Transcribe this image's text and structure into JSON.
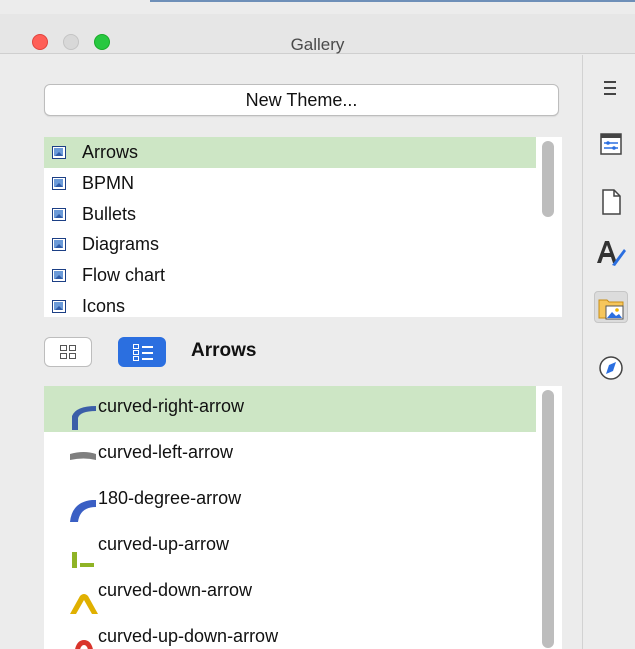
{
  "window": {
    "title": "Gallery"
  },
  "gallery": {
    "new_theme_label": "New Theme...",
    "themes": [
      {
        "label": "Arrows",
        "selected": true
      },
      {
        "label": "BPMN",
        "selected": false
      },
      {
        "label": "Bullets",
        "selected": false
      },
      {
        "label": "Diagrams",
        "selected": false
      },
      {
        "label": "Flow chart",
        "selected": false
      },
      {
        "label": "Icons",
        "selected": false
      }
    ],
    "view_mode": "list",
    "current_theme": "Arrows",
    "items": [
      {
        "label": "curved-right-arrow",
        "selected": true,
        "thumb_color": "#3b5ea8",
        "thumb_icon": "curved-right-arrow-icon"
      },
      {
        "label": "curved-left-arrow",
        "selected": false,
        "thumb_color": "#7f7f7f",
        "thumb_icon": "curved-left-arrow-icon"
      },
      {
        "label": "180-degree-arrow",
        "selected": false,
        "thumb_color": "#3a5fc4",
        "thumb_icon": "180-degree-arrow-icon"
      },
      {
        "label": "curved-up-arrow",
        "selected": false,
        "thumb_color": "#8fb325",
        "thumb_icon": "curved-up-arrow-icon"
      },
      {
        "label": "curved-down-arrow",
        "selected": false,
        "thumb_color": "#e0b000",
        "thumb_icon": "curved-down-arrow-icon"
      },
      {
        "label": "curved-up-down-arrow",
        "selected": false,
        "thumb_color": "#d9342b",
        "thumb_icon": "curved-up-down-arrow-icon"
      }
    ]
  },
  "sidebar_tabs": [
    {
      "icon": "menu-icon",
      "active": false
    },
    {
      "icon": "properties-icon",
      "active": false
    },
    {
      "icon": "page-icon",
      "active": false
    },
    {
      "icon": "styles-icon",
      "active": false
    },
    {
      "icon": "gallery-icon",
      "active": true
    },
    {
      "icon": "navigator-icon",
      "active": false
    }
  ]
}
